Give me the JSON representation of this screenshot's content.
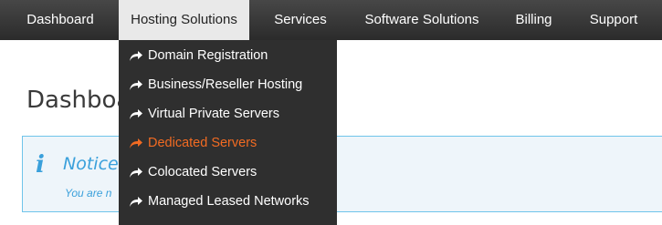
{
  "nav": {
    "items": [
      {
        "label": "Dashboard"
      },
      {
        "label": "Hosting Solutions",
        "active": true
      },
      {
        "label": "Services"
      },
      {
        "label": "Software Solutions"
      },
      {
        "label": "Billing"
      },
      {
        "label": "Support"
      }
    ]
  },
  "main": {
    "title": "Dashboard"
  },
  "notice": {
    "icon": "i",
    "title": "Notice",
    "text": "You are n"
  },
  "dropdown": {
    "icon": "share-arrow-icon",
    "highlight_color": "#f26b22",
    "items": [
      {
        "label": "Domain Registration"
      },
      {
        "label": "Business/Reseller Hosting"
      },
      {
        "label": "Virtual Private Servers"
      },
      {
        "label": "Dedicated Servers",
        "hovered": true
      },
      {
        "label": "Colocated Servers"
      },
      {
        "label": "Managed Leased Networks"
      }
    ]
  }
}
